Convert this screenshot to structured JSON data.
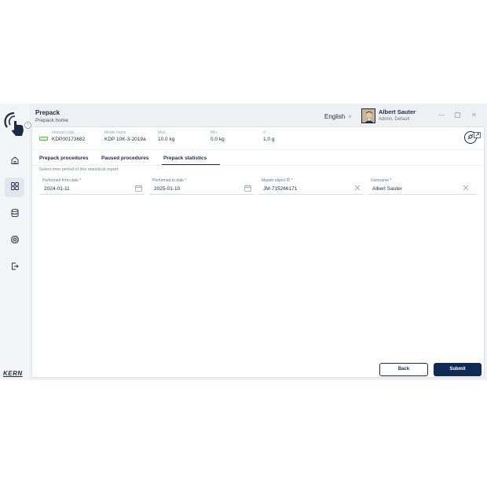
{
  "header": {
    "title": "Prepack",
    "subtitle": "Prepack home",
    "language": "English",
    "user_name": "Albert Sauter",
    "user_role": "Admin, Default"
  },
  "sidebar": {
    "items": [
      {
        "icon": "home-icon"
      },
      {
        "icon": "grid-icon",
        "active": true
      },
      {
        "icon": "database-icon"
      },
      {
        "icon": "gear-icon"
      },
      {
        "icon": "logout-icon"
      }
    ],
    "brand": "KERN"
  },
  "device": {
    "internal_code_label": "Internal code",
    "internal_code": "KDP00173682",
    "model_name_label": "Model name",
    "model_name": "KDP 10K-3-2019a",
    "max_label": "Max",
    "max": "10.0 kg",
    "min_label": "Min",
    "min": "0.0 kg",
    "d_label": "d",
    "d": "1.0 g"
  },
  "tabs": [
    {
      "label": "Prepack procedures"
    },
    {
      "label": "Paused procedures"
    },
    {
      "label": "Prepack statistics",
      "active": true
    }
  ],
  "form": {
    "hint": "Select time period of this statistical report",
    "performed_from": {
      "label": "Performed from date *",
      "value": "2024-01-11"
    },
    "performed_to": {
      "label": "Performed to date *",
      "value": "2025-01-10"
    },
    "master_object": {
      "label": "Master object ID *",
      "value": "JM-715266171"
    },
    "username": {
      "label": "Username *",
      "value": "Albert Sauter"
    }
  },
  "actions": {
    "back_label": "Back",
    "submit_label": "Submit"
  },
  "colors": {
    "primary": "#0f2a55",
    "text": "#1c2b45",
    "device_indicator": "#6ab04c"
  }
}
